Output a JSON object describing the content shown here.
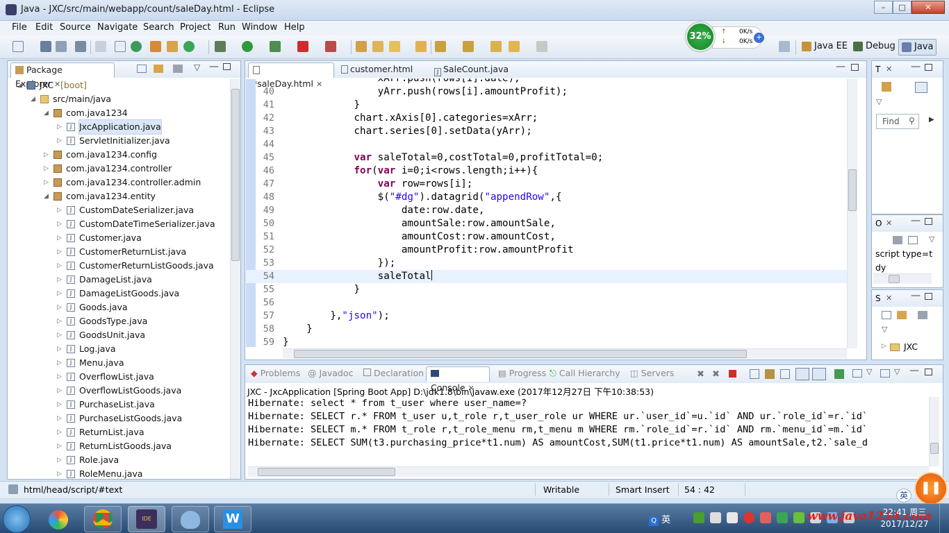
{
  "window": {
    "title": "Java - JXC/src/main/webapp/count/saleDay.html - Eclipse"
  },
  "menu": [
    "File",
    "Edit",
    "Source",
    "Navigate",
    "Search",
    "Project",
    "Run",
    "Window",
    "Help"
  ],
  "perf_badge": {
    "percent": "32%",
    "up": "0K/s",
    "down": "0K/s"
  },
  "perspectives": [
    "Java EE",
    "Debug",
    "Java"
  ],
  "package_explorer": {
    "title": "Package Explorer",
    "tree": [
      {
        "label": "JXC",
        "suffix": "[boot]"
      },
      {
        "label": "src/main/java"
      },
      {
        "label": "com.java1234"
      },
      {
        "label": "JxcApplication.java"
      },
      {
        "label": "ServletInitializer.java"
      },
      {
        "label": "com.java1234.config"
      },
      {
        "label": "com.java1234.controller"
      },
      {
        "label": "com.java1234.controller.admin"
      },
      {
        "label": "com.java1234.entity"
      },
      {
        "label": "CustomDateSerializer.java"
      },
      {
        "label": "CustomDateTimeSerializer.java"
      },
      {
        "label": "Customer.java"
      },
      {
        "label": "CustomerReturnList.java"
      },
      {
        "label": "CustomerReturnListGoods.java"
      },
      {
        "label": "DamageList.java"
      },
      {
        "label": "DamageListGoods.java"
      },
      {
        "label": "Goods.java"
      },
      {
        "label": "GoodsType.java"
      },
      {
        "label": "GoodsUnit.java"
      },
      {
        "label": "Log.java"
      },
      {
        "label": "Menu.java"
      },
      {
        "label": "OverflowList.java"
      },
      {
        "label": "OverflowListGoods.java"
      },
      {
        "label": "PurchaseList.java"
      },
      {
        "label": "PurchaseListGoods.java"
      },
      {
        "label": "ReturnList.java"
      },
      {
        "label": "ReturnListGoods.java"
      },
      {
        "label": "Role.java"
      },
      {
        "label": "RoleMenu.java"
      }
    ]
  },
  "editor": {
    "tabs": [
      "*saleDay.html",
      "customer.html",
      "SaleCount.java"
    ],
    "lines": [
      {
        "n": "40",
        "text": "                yArr.push(rows[i].amountProfit);"
      },
      {
        "n": "41",
        "text": "            }"
      },
      {
        "n": "42",
        "text": "            chart.xAxis[0].categories=xArr;"
      },
      {
        "n": "43",
        "text": "            chart.series[0].setData(yArr);"
      },
      {
        "n": "44",
        "text": ""
      },
      {
        "n": "45",
        "text": "            var saleTotal=0,costTotal=0,profitTotal=0;"
      },
      {
        "n": "46",
        "text": "            for(var i=0;i<rows.length;i++){"
      },
      {
        "n": "47",
        "text": "                var row=rows[i];"
      },
      {
        "n": "48",
        "text": "                $(\"#dg\").datagrid(\"appendRow\",{"
      },
      {
        "n": "49",
        "text": "                    date:row.date,"
      },
      {
        "n": "50",
        "text": "                    amountSale:row.amountSale,"
      },
      {
        "n": "51",
        "text": "                    amountCost:row.amountCost,"
      },
      {
        "n": "52",
        "text": "                    amountProfit:row.amountProfit"
      },
      {
        "n": "53",
        "text": "                });"
      },
      {
        "n": "54",
        "text": "                saleTotal"
      },
      {
        "n": "55",
        "text": "            }"
      },
      {
        "n": "56",
        "text": ""
      },
      {
        "n": "57",
        "text": "        },\"json\");"
      },
      {
        "n": "58",
        "text": "    }"
      },
      {
        "n": "59",
        "text": "}"
      }
    ],
    "partial_top": "                xArr.push(rows[i].date);"
  },
  "right_panels": {
    "top_title": "T",
    "find_placeholder": "Find",
    "outline_title": "O",
    "outline_text1": "script type=t",
    "outline_text2": "dy",
    "servers_title": "S",
    "servers_item": "JXC"
  },
  "console_panel": {
    "tabs": [
      "Problems",
      "Javadoc",
      "Declaration",
      "Console",
      "Progress",
      "Call Hierarchy",
      "Servers"
    ],
    "header": "JXC - JxcApplication [Spring Boot App] D:\\jdk1.8\\bin\\javaw.exe (2017年12月27日 下午10:38:53)",
    "lines": [
      "Hibernate: select * from t_user where user_name=?",
      "Hibernate: SELECT r.* FROM t_user u,t_role r,t_user_role ur WHERE ur.`user_id`=u.`id` AND ur.`role_id`=r.`id`",
      "Hibernate: SELECT m.* FROM t_role r,t_role_menu rm,t_menu m WHERE rm.`role_id`=r.`id` AND rm.`menu_id`=m.`id`",
      "Hibernate: SELECT SUM(t3.purchasing_price*t1.num) AS amountCost,SUM(t1.price*t1.num) AS amountSale,t2.`sale_d"
    ]
  },
  "statusbar": {
    "path": "html/head/script/#text",
    "mode": "Writable",
    "insert": "Smart Insert",
    "position": "54 : 42"
  },
  "taskbar": {
    "ime": "英",
    "time": "22:41 周三",
    "date": "2017/12/27",
    "watermark": "www.java1234.com",
    "ime_float": "英"
  }
}
